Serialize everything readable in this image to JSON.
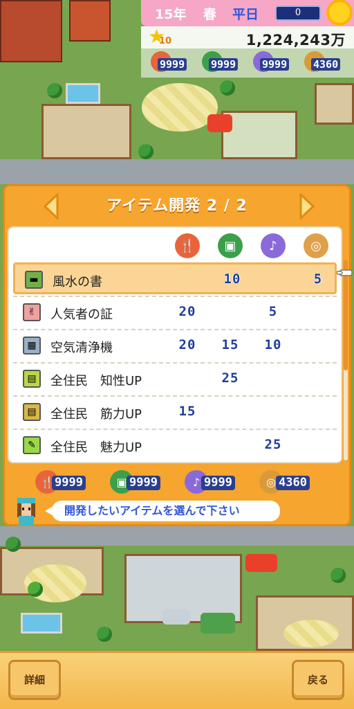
{
  "hud": {
    "year": "15年",
    "season": "春",
    "day_type": "平日",
    "weather_value": "0",
    "star_level": "10",
    "money": "1,224,243万",
    "resources": [
      {
        "icon": "food-icon",
        "value": "9999",
        "color": "#e8643a"
      },
      {
        "icon": "bag-icon",
        "value": "9999",
        "color": "#3ca04a"
      },
      {
        "icon": "music-icon",
        "value": "9999",
        "color": "#8a6ad8"
      },
      {
        "icon": "coin-icon",
        "value": "4360",
        "color": "#d89a3a"
      }
    ]
  },
  "dialog": {
    "title": "アイテム開発 2 / 2",
    "categories": [
      {
        "icon": "food-icon",
        "color": "#e8643a"
      },
      {
        "icon": "bag-icon",
        "color": "#3ca04a"
      },
      {
        "icon": "music-icon",
        "color": "#8a6ad8"
      },
      {
        "icon": "coin-icon",
        "color": "#e0a04a"
      }
    ],
    "items": [
      {
        "name": "風水の書",
        "icon": "book-icon",
        "icon_color": "#6fb04a",
        "costs": [
          "",
          "10",
          "",
          "5"
        ],
        "selected": true
      },
      {
        "name": "人気者の証",
        "icon": "peace-sign-icon",
        "icon_color": "#f0a0a0",
        "costs": [
          "20",
          "",
          "5",
          ""
        ],
        "selected": false
      },
      {
        "name": "空気清浄機",
        "icon": "air-purifier-icon",
        "icon_color": "#9ab0c8",
        "costs": [
          "20",
          "15",
          "10",
          ""
        ],
        "selected": false
      },
      {
        "name": "全住民　知性UP",
        "icon": "scroll-icon",
        "icon_color": "#b8d84a",
        "costs": [
          "",
          "25",
          "",
          ""
        ],
        "selected": false
      },
      {
        "name": "全住民　筋力UP",
        "icon": "scroll-icon",
        "icon_color": "#d8b84a",
        "costs": [
          "15",
          "",
          "",
          ""
        ],
        "selected": false
      },
      {
        "name": "全住民　魅力UP",
        "icon": "wand-icon",
        "icon_color": "#9ad84a",
        "costs": [
          "",
          "",
          "25",
          ""
        ],
        "selected": false
      }
    ],
    "stock": [
      {
        "icon": "food-icon",
        "value": "9999",
        "color": "#e8643a"
      },
      {
        "icon": "bag-icon",
        "value": "9999",
        "color": "#3ca04a"
      },
      {
        "icon": "music-icon",
        "value": "9999",
        "color": "#8a6ad8"
      },
      {
        "icon": "coin-icon",
        "value": "4360",
        "color": "#d89a3a"
      }
    ],
    "message": "開発したいアイテムを選んで下さい"
  },
  "buttons": {
    "detail": "詳細",
    "back": "戻る"
  }
}
